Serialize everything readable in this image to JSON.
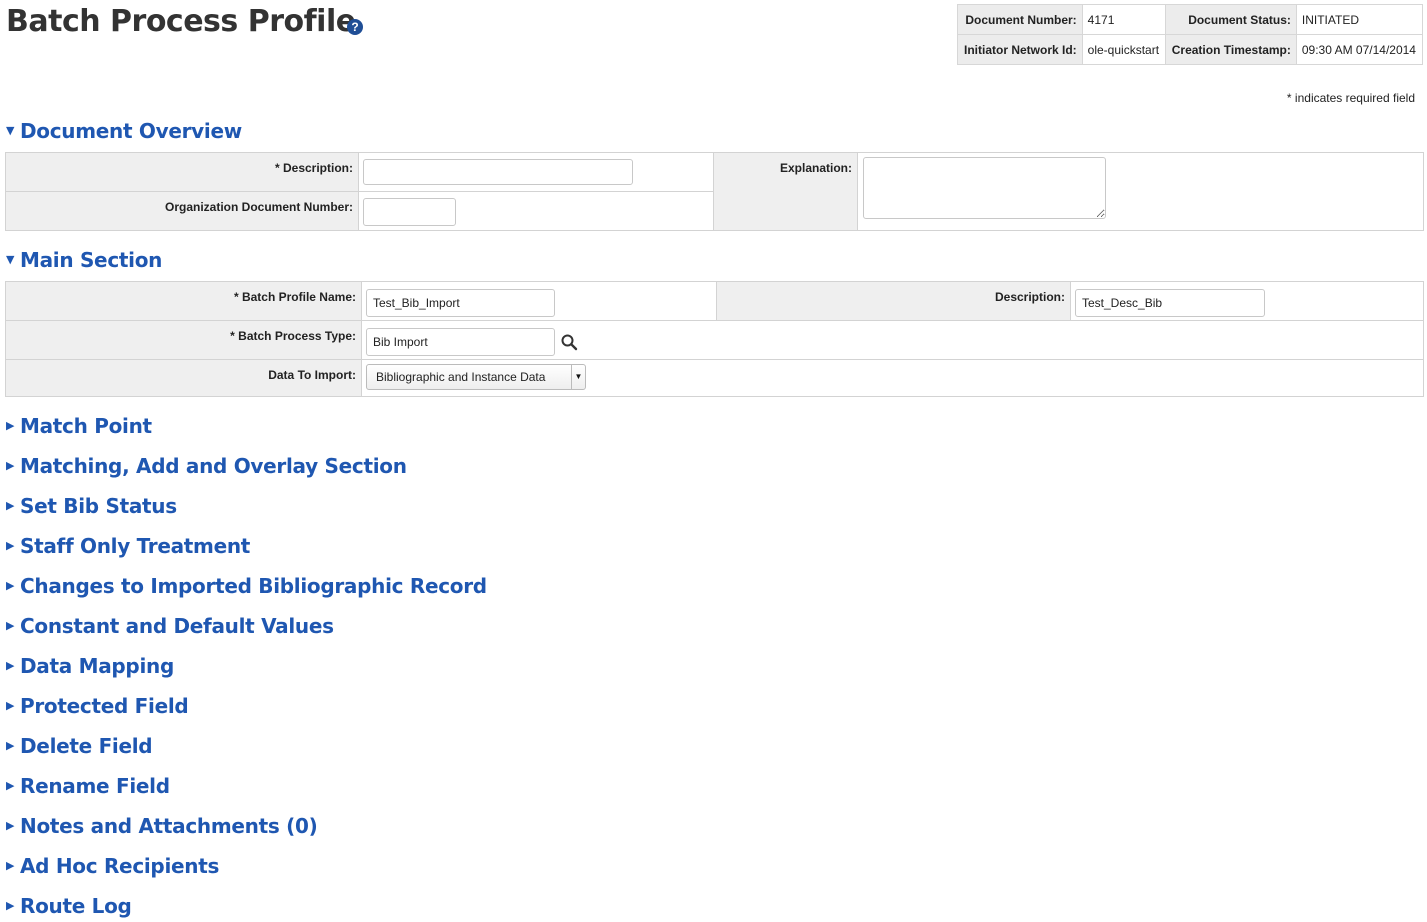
{
  "page": {
    "title": "Batch Process Profile",
    "help_icon": "?",
    "required_note": "* indicates required field"
  },
  "doc_header": {
    "document_number_label": "Document Number:",
    "document_number": "4171",
    "document_status_label": "Document Status:",
    "document_status": "INITIATED",
    "initiator_label": "Initiator Network Id:",
    "initiator": "ole-quickstart",
    "creation_timestamp_label": "Creation Timestamp:",
    "creation_timestamp": "09:30 AM 07/14/2014"
  },
  "document_overview": {
    "title": "Document Overview",
    "description_label": "* Description:",
    "description_value": "",
    "org_doc_number_label": "Organization Document Number:",
    "org_doc_number_value": "",
    "explanation_label": "Explanation:",
    "explanation_value": ""
  },
  "main_section": {
    "title": "Main Section",
    "batch_profile_name_label": "* Batch Profile Name:",
    "batch_profile_name_value": "Test_Bib_Import",
    "description_label": "Description:",
    "description_value": "Test_Desc_Bib",
    "batch_process_type_label": "* Batch Process Type:",
    "batch_process_type_value": "Bib Import",
    "data_to_import_label": "Data To Import:",
    "data_to_import_value": "Bibliographic and Instance Data"
  },
  "collapsed_sections": [
    "Match Point",
    "Matching, Add and Overlay Section",
    "Set Bib Status",
    "Staff Only Treatment",
    "Changes to Imported Bibliographic Record",
    "Constant and Default Values",
    "Data Mapping",
    "Protected Field",
    "Delete Field",
    "Rename Field",
    "Notes and Attachments (0)",
    "Ad Hoc Recipients",
    "Route Log"
  ],
  "icons": {
    "expanded": "triangle-down-icon",
    "collapsed": "triangle-right-icon",
    "lookup": "search-icon",
    "help": "help-icon"
  },
  "colors": {
    "section_title": "#1f57b1",
    "panel_bg": "#efefef",
    "border": "#d3d3d3"
  }
}
